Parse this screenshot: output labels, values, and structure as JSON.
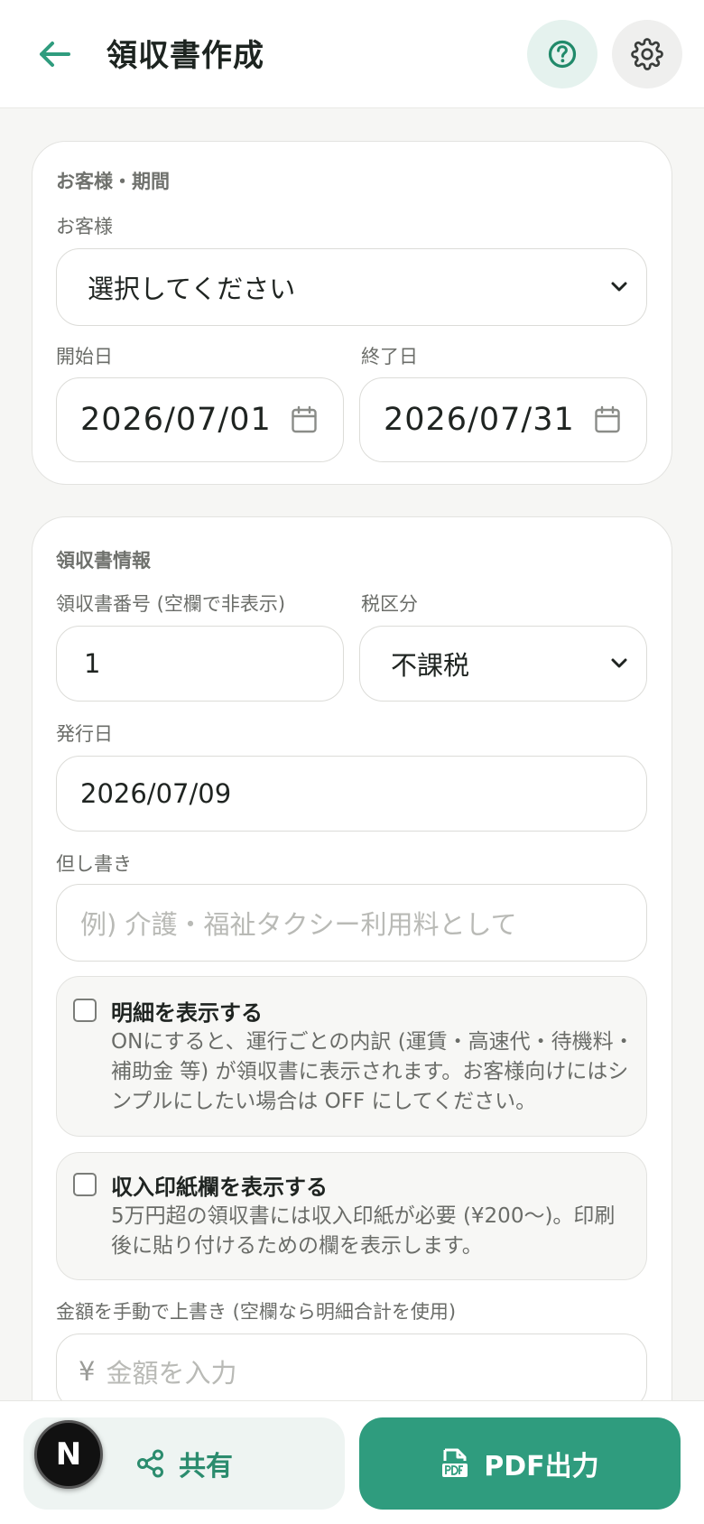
{
  "header": {
    "title": "領収書作成",
    "back_icon": "arrow-left-icon",
    "help_icon": "help-circle-icon",
    "settings_icon": "gear-icon"
  },
  "customer_section": {
    "title": "お客様・期間",
    "customer_label": "お客様",
    "customer_value": "選択してください",
    "start_label": "開始日",
    "start_value": "2026/07/01",
    "end_label": "終了日",
    "end_value": "2026/07/31"
  },
  "receipt_section": {
    "title": "領収書情報",
    "number_label": "領収書番号 (空欄で非表示)",
    "number_value": "1",
    "tax_label": "税区分",
    "tax_value": "不課税",
    "issue_label": "発行日",
    "issue_value": "2026/07/09",
    "memo_label": "但し書き",
    "memo_placeholder": "例) 介護・福祉タクシー利用料として",
    "detail_title": "明細を表示する",
    "detail_desc": "ONにすると、運行ごとの内訳 (運賃・高速代・待機料・補助金 等) が領収書に表示されます。お客様向けにはシンプルにしたい場合は OFF にしてください。",
    "stamp_title": "収入印紙欄を表示する",
    "stamp_desc": "5万円超の領収書には収入印紙が必要 (¥200〜)。印刷後に貼り付けるための欄を表示します。",
    "amount_label": "金額を手動で上書き (空欄なら明細合計を使用)",
    "amount_prefix": "¥",
    "amount_placeholder": "金額を入力"
  },
  "bottom": {
    "share_label": "共有",
    "pdf_label": "PDF出力",
    "badge": "N"
  },
  "colors": {
    "accent": "#2f9c7e",
    "accent_light": "#e5f2ee"
  }
}
